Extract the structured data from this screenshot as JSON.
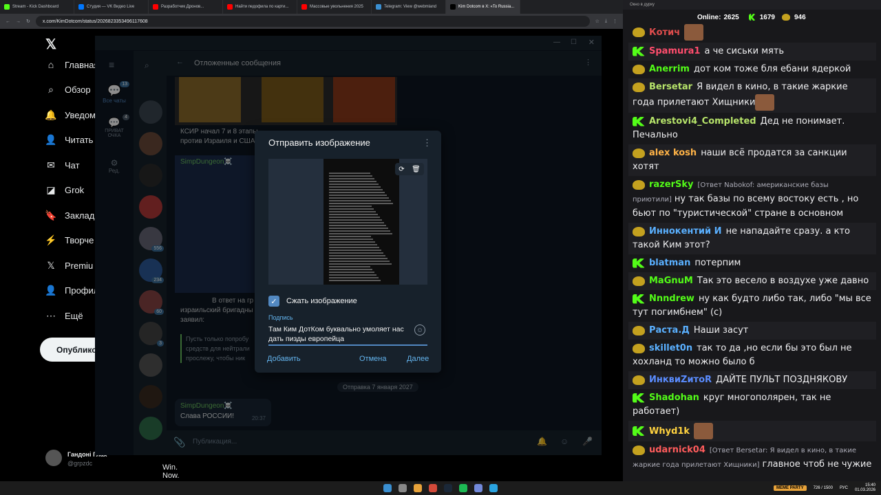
{
  "browser": {
    "tabs": [
      {
        "label": "Stream - Kick Dashboard",
        "color": "#53fc18"
      },
      {
        "label": "Студия — VK Видео Live",
        "color": "#0077ff"
      },
      {
        "label": "Разработчик Дронов...",
        "color": "#ff0000"
      },
      {
        "label": "Найти педофила по карти...",
        "color": "#ff0000"
      },
      {
        "label": "Массовые увольнения 2025",
        "color": "#ff0000"
      },
      {
        "label": "Telegram: View @webmland",
        "color": "#3a8fd1"
      },
      {
        "label": "Kim Dotcom в X: «To Russia...",
        "color": "#000000"
      }
    ],
    "url": "x.com/KimDotcom/status/2026823353496117608"
  },
  "x_sidebar": {
    "items": [
      {
        "icon": "home-icon",
        "glyph": "⌂",
        "label": "Главная"
      },
      {
        "icon": "search-icon",
        "glyph": "⌕",
        "label": "Обзор"
      },
      {
        "icon": "bell-icon",
        "glyph": "🔔",
        "label": "Уведом"
      },
      {
        "icon": "person-add-icon",
        "glyph": "👤",
        "label": "Читать"
      },
      {
        "icon": "mail-icon",
        "glyph": "✉",
        "label": "Чат"
      },
      {
        "icon": "grok-icon",
        "glyph": "◪",
        "label": "Grok"
      },
      {
        "icon": "bookmark-icon",
        "glyph": "🔖",
        "label": "Заклад"
      },
      {
        "icon": "bolt-icon",
        "glyph": "⚡",
        "label": "Творче"
      },
      {
        "icon": "x-logo-icon",
        "glyph": "𝕏",
        "label": "Premiu"
      },
      {
        "icon": "profile-icon",
        "glyph": "👤",
        "label": "Профил"
      },
      {
        "icon": "more-icon",
        "glyph": "⋯",
        "label": "Ещё"
      }
    ],
    "post_button": "Опубликов",
    "account_name": "Гандоні Глах",
    "account_handle": "@grpzdc",
    "bottom_text": "Win. Now."
  },
  "telegram": {
    "header_title": "Отложенные сообщения",
    "folders": [
      {
        "label": "Все чаты",
        "badge": "13"
      },
      {
        "label": "ПРИВАТ ОЧКА",
        "badge": "4"
      },
      {
        "label": "Ред.",
        "badge": ""
      }
    ],
    "chat_badges": [
      "556",
      "234",
      "60",
      "3"
    ],
    "messages": [
      {
        "text": "КСИР начал 7 и 8 этапы",
        "sub": "против Израиля и США"
      },
      {
        "author": "SimpDungeon☠️"
      },
      {
        "text": "В ответ на гр",
        "sub": "израильский бригадны",
        "sub2": "заявил:"
      },
      {
        "quote": "Пусть только попробу средств для нейтрали прослежу, чтобы ник"
      }
    ],
    "date_divider": "Отправка 7 января 2027",
    "last_author": "SimpDungeon☠️",
    "last_text": "Слава РОССИИ!",
    "last_time": "20:37",
    "input_placeholder": "Публикация..."
  },
  "dialog": {
    "title": "Отправить изображение",
    "compress_label": "Сжать изображение",
    "caption_label": "Подпись",
    "caption_text": "Там Ким ДотКом буквально умоляет нас дать пизды европейца",
    "add_button": "Добавить",
    "cancel_button": "Отмена",
    "next_button": "Далее",
    "accent": "#5288c1"
  },
  "stream_chat": {
    "window_title": "Окно в дурку",
    "online_label": "Online:",
    "online_count": "2625",
    "kick_count": "1679",
    "vk_count": "946",
    "messages": [
      {
        "badge": "p",
        "user": "Котич",
        "color": "#e04d4d",
        "text": "",
        "emote": true
      },
      {
        "badge": "k",
        "user": "Spamura1",
        "color": "#ff4d6d",
        "text": "а че сиськи мять"
      },
      {
        "badge": "p",
        "user": "Anerrim",
        "color": "#53fc18",
        "text": "дот ком тоже бля ебани ядеркой"
      },
      {
        "badge": "p",
        "user": "Bersetar",
        "color": "#b6e36a",
        "text": "Я видел в кино, в такие жаркие года прилетают Хищники",
        "emote": true
      },
      {
        "badge": "k",
        "user": "Arestovi4_Completed",
        "color": "#b6e36a",
        "text": "Дед не понимает. Печально"
      },
      {
        "badge": "p",
        "user": "alex kosh",
        "color": "#ffb347",
        "text": "наши всё продатся за санкции хотят"
      },
      {
        "badge": "p",
        "user": "razerSky",
        "color": "#53fc18",
        "reply": "[Ответ Nabokof: американские базы приютили]",
        "text": "ну так базы по всему востоку есть , но бьют по \"туристической\" стране в основном"
      },
      {
        "badge": "p",
        "user": "Иннокентий И",
        "color": "#5ab0ff",
        "text": "не нападайте сразу. а кто такой Ким этот?"
      },
      {
        "badge": "k",
        "user": "blatman",
        "color": "#5ab0ff",
        "text": "потерпим"
      },
      {
        "badge": "p",
        "user": "MaGnuM",
        "color": "#53fc18",
        "text": "Так это весело в воздухе уже давно"
      },
      {
        "badge": "k",
        "user": "Nnndrew",
        "color": "#53fc18",
        "text": "ну как будто либо так, либо \"мы все тут погимбнем\" (с)"
      },
      {
        "badge": "p",
        "user": "Раста.Д",
        "color": "#5ab0ff",
        "text": "Наши засут"
      },
      {
        "badge": "p",
        "user": "skillet0n",
        "color": "#5ab0ff",
        "text": "так то да ,но если бы это был не хохланд то можно было б"
      },
      {
        "badge": "p",
        "user": "ИнквиZитоR",
        "color": "#5a8cff",
        "text": "ДАЙТЕ ПУЛЬТ ПОЗДНЯКОВУ"
      },
      {
        "badge": "k",
        "user": "Shadohan",
        "color": "#53fc18",
        "text": "круг многополярен, так не работает)"
      },
      {
        "badge": "k",
        "user": "Whyd1k",
        "color": "#ffd23f",
        "text": "",
        "emote": true
      },
      {
        "badge": "p",
        "user": "udarnick04",
        "color": "#ff5c5c",
        "reply": "[Ответ Bersetar: Я видел в кино, в такие жаркие года прилетают Хищники]",
        "text": "главное чтоб не чужие"
      }
    ]
  },
  "taskbar": {
    "lang": "РУС",
    "time": "15:40",
    "date": "01.03.2026",
    "meme_label": "MEME PARTY",
    "meme_count": "726 / 1500"
  }
}
